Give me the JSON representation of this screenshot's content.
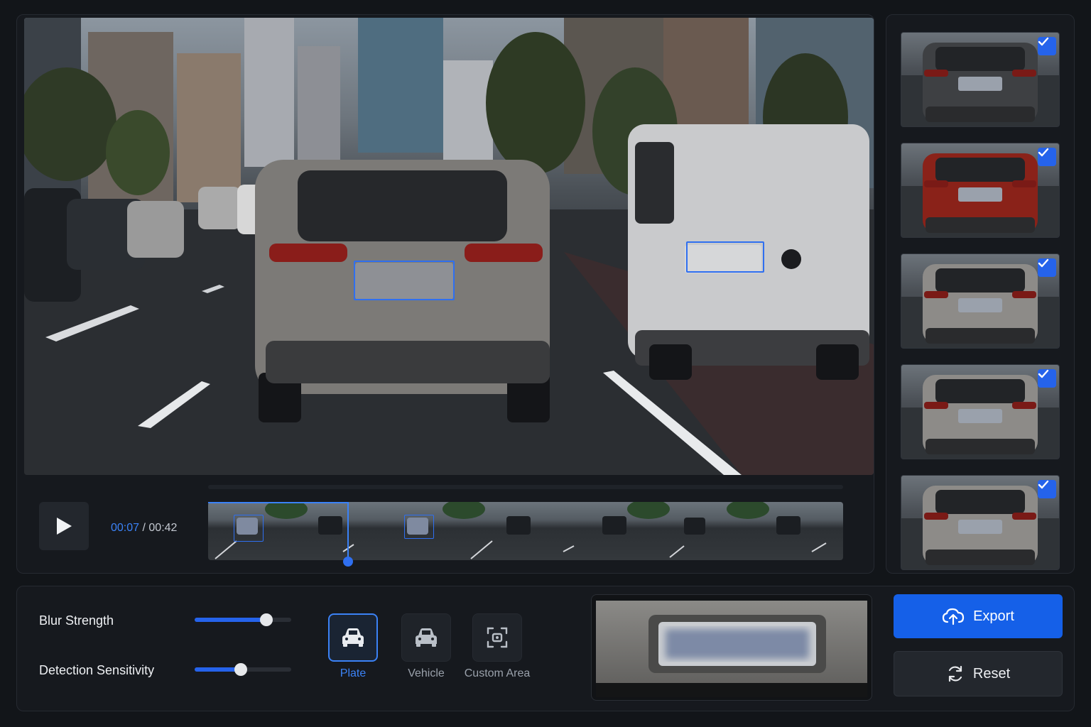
{
  "player": {
    "current_time": "00:07",
    "separator": " / ",
    "total_time": "00:42",
    "progress": 0.22,
    "state": "paused"
  },
  "thumbnails": [
    {
      "vehicle": "dark-suv",
      "selected": true
    },
    {
      "vehicle": "red-suv",
      "selected": true
    },
    {
      "vehicle": "silver-suv",
      "selected": true
    },
    {
      "vehicle": "silver-suv",
      "selected": true
    },
    {
      "vehicle": "silver-suv",
      "selected": true
    }
  ],
  "controls": {
    "blur_strength": {
      "label": "Blur Strength",
      "value": 0.74
    },
    "detection_sensitivity": {
      "label": "Detection Sensitivity",
      "value": 0.48
    },
    "modes": [
      {
        "id": "plate",
        "label": "Plate",
        "icon": "car-icon",
        "active": true
      },
      {
        "id": "vehicle",
        "label": "Vehicle",
        "icon": "car-icon",
        "active": false
      },
      {
        "id": "custom",
        "label": "Custom Area",
        "icon": "custom-area-icon",
        "active": false
      }
    ]
  },
  "actions": {
    "export_label": "Export",
    "export_icon": "cloud-upload-icon",
    "reset_label": "Reset",
    "reset_icon": "refresh-icon"
  },
  "colors": {
    "accent": "#2563eb",
    "accent_text": "#3b82f6",
    "background": "#121519",
    "panel": "#16191e"
  }
}
